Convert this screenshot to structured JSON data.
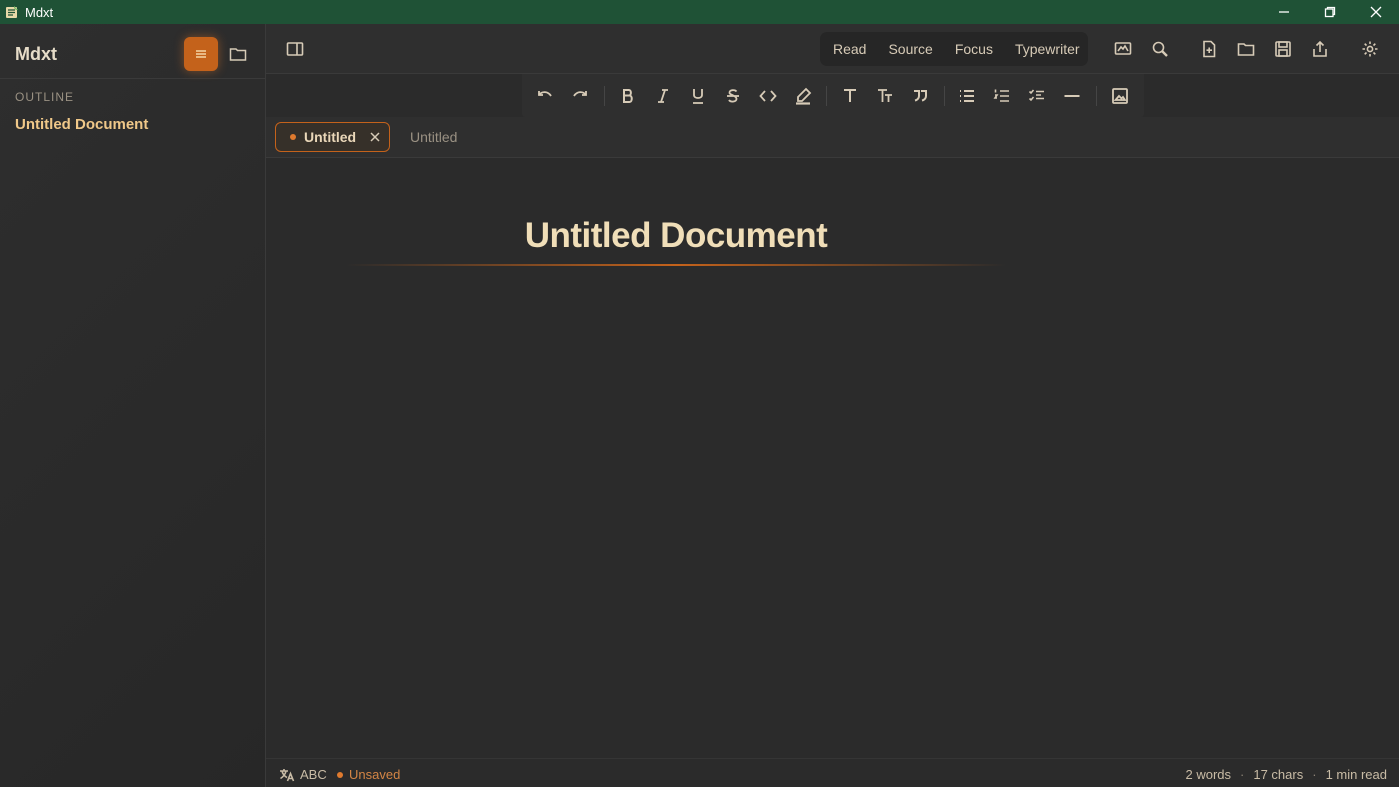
{
  "window": {
    "title": "Mdxt"
  },
  "sidebar": {
    "brand": "Mdxt",
    "section_label": "OUTLINE",
    "outline_items": [
      "Untitled Document"
    ]
  },
  "toolbar": {
    "modes": [
      "Read",
      "Source",
      "Focus",
      "Typewriter"
    ]
  },
  "tabs": {
    "active_label": "Untitled",
    "inactive_label": "Untitled"
  },
  "document": {
    "title": "Untitled Document"
  },
  "status": {
    "spellcheck": "ABC",
    "save_state": "Unsaved",
    "words": "2 words",
    "chars": "17 chars",
    "read_time": "1 min read",
    "separator": "·"
  },
  "colors": {
    "titlebar": "#1f5236",
    "accent": "#c4621b",
    "heading": "#f0deb8",
    "outline_item": "#f0c889"
  }
}
